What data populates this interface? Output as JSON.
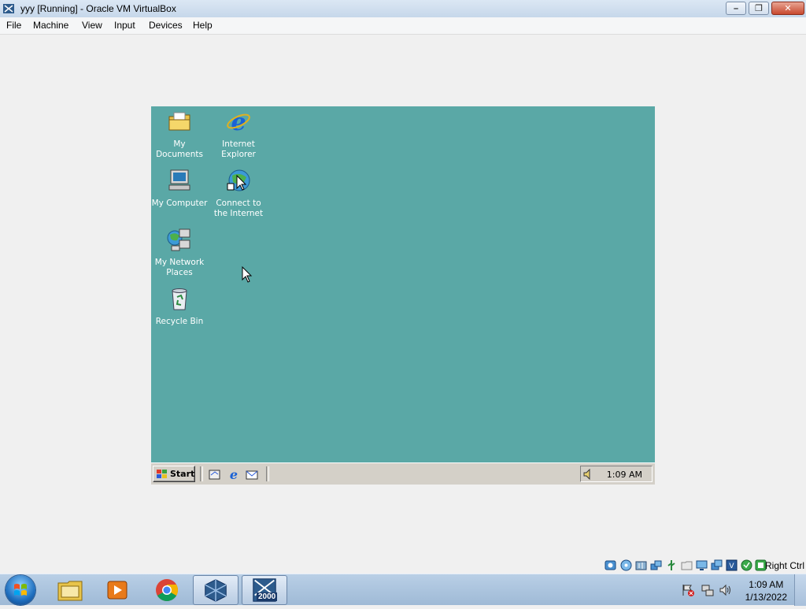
{
  "window": {
    "title": "yyy [Running] - Oracle VM VirtualBox",
    "controls": [
      "minimize",
      "restore",
      "close"
    ]
  },
  "menu": {
    "items": [
      "File",
      "Machine",
      "View",
      "Input",
      "Devices",
      "Help"
    ]
  },
  "guest": {
    "desktop_color": "#5aa8a6",
    "icons": [
      {
        "label": "My Documents",
        "icon": "my-documents-icon"
      },
      {
        "label": "Internet\nExplorer",
        "icon": "internet-explorer-icon"
      },
      {
        "label": "My Computer",
        "icon": "my-computer-icon"
      },
      {
        "label": "Connect to\nthe Internet",
        "icon": "connect-internet-icon"
      },
      {
        "label": "My Network\nPlaces",
        "icon": "network-places-icon"
      },
      {
        "label": "Recycle Bin",
        "icon": "recycle-bin-icon"
      }
    ],
    "taskbar": {
      "start_label": "Start",
      "quick_launch": [
        "show-desktop-icon",
        "internet-explorer-icon",
        "outlook-express-icon"
      ],
      "clock": "1:09 AM"
    }
  },
  "statusbar": {
    "icons": [
      "hard-disk-icon",
      "optical-drive-icon",
      "audio-icon",
      "network-icon",
      "usb-icon",
      "shared-folders-icon",
      "display-icon",
      "video-capture-icon",
      "cpu-icon",
      "mouse-integration-icon",
      "keyboard-icon"
    ],
    "host_key": "Right Ctrl"
  },
  "host_taskbar": {
    "apps": [
      "windows-explorer-icon",
      "media-player-icon",
      "chrome-icon",
      "virtualbox-icon",
      "windows-2000-vm-icon"
    ],
    "vm_badge": "2000",
    "clock_time": "1:09 AM",
    "clock_date": "1/13/2022"
  }
}
